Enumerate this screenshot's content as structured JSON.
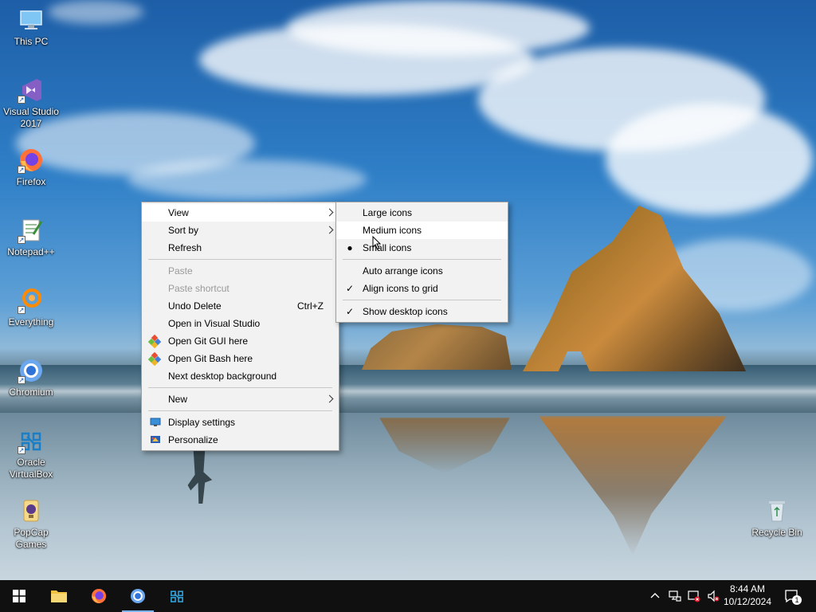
{
  "desktop_icons": [
    {
      "label": "This PC"
    },
    {
      "label": "Visual Studio 2017"
    },
    {
      "label": "Firefox"
    },
    {
      "label": "Notepad++"
    },
    {
      "label": "Everything"
    },
    {
      "label": "Chromium"
    },
    {
      "label": "Oracle VirtualBox"
    },
    {
      "label": "PopCap Games"
    },
    {
      "label": "Recycle Bin"
    }
  ],
  "context_menu": {
    "items": {
      "view": "View",
      "sort_by": "Sort by",
      "refresh": "Refresh",
      "paste": "Paste",
      "paste_shortcut": "Paste shortcut",
      "undo_delete": "Undo Delete",
      "undo_delete_shortcut": "Ctrl+Z",
      "open_vs": "Open in Visual Studio",
      "git_gui": "Open Git GUI here",
      "git_bash": "Open Git Bash here",
      "next_bg": "Next desktop background",
      "new": "New",
      "display_settings": "Display settings",
      "personalize": "Personalize"
    }
  },
  "view_submenu": {
    "large_icons": "Large icons",
    "medium_icons": "Medium icons",
    "small_icons": "Small icons",
    "auto_arrange": "Auto arrange icons",
    "align_grid": "Align icons to grid",
    "show_desktop_icons": "Show desktop icons",
    "selected_size": "Small icons",
    "checked": [
      "Align icons to grid",
      "Show desktop icons"
    ]
  },
  "taskbar": {
    "time": "8:44 AM",
    "date": "10/12/2024",
    "notification_count": "1"
  },
  "colors": {
    "taskbar_bg": "#101010",
    "menu_bg": "#f2f2f2",
    "accent": "#7ab4f0"
  }
}
